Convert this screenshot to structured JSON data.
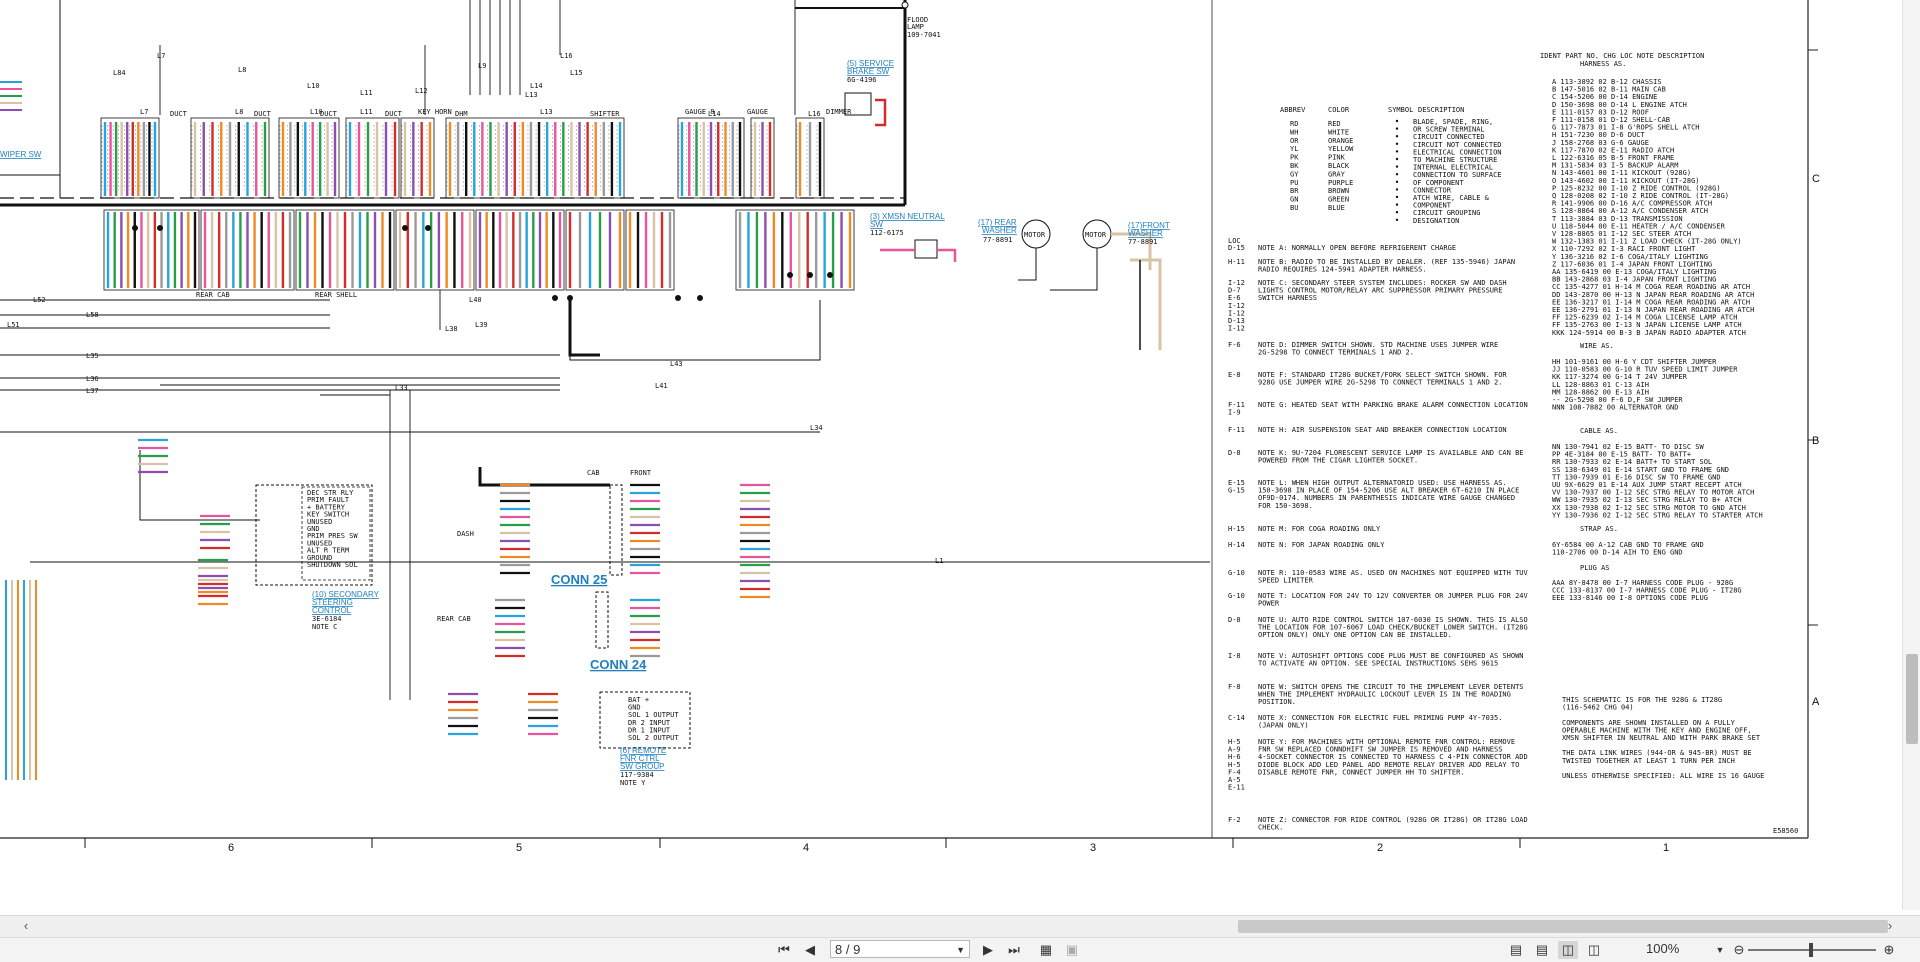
{
  "document": {
    "grid_columns": [
      "6",
      "5",
      "4",
      "3",
      "2",
      "1"
    ],
    "grid_rows": [
      "C",
      "B",
      "A"
    ],
    "drawing_no": "E58560"
  },
  "labels": {
    "flood_lamp": [
      "FLOOD",
      "LAMP",
      "109-7041"
    ],
    "service_brake": [
      "(5) SERVICE",
      "BRAKE SW",
      "6G-4196"
    ],
    "xmsn_neutral": [
      "(3) XMSN NEUTRAL",
      "SW",
      "112-6175"
    ],
    "rear_washer": [
      "(17) REAR",
      "WASHER",
      "77-8891"
    ],
    "front_washer": [
      "(17)FRONT",
      "WASHER",
      "77-8891"
    ],
    "secondary_steering": [
      "(10) SECONDARY",
      "STEERING",
      "CONTROL",
      "3E-6184",
      "NOTE C"
    ],
    "remote_fnr": [
      "(6) REMOTE",
      "FNR CTRL",
      "SW GROUP",
      "117-9384",
      "NOTE Y"
    ],
    "wiper_sw": "WIPER SW",
    "motor": "MOTOR",
    "conn25": "CONN 25",
    "conn24": "CONN 24",
    "cab": "CAB",
    "front": "FRONT",
    "dash": "DASH",
    "rear_cab": "REAR CAB",
    "rear_cab2": "REAR CAB",
    "rear_shell": "REAR SHELL"
  },
  "harness_headers": [
    "L7",
    "DUCT",
    "L8",
    "DUCT",
    "L10",
    "DUCT",
    "L11",
    "DUCT",
    "KEY HORN",
    "DHM",
    "L13",
    "SHIFTER",
    "GAUGE 8",
    "L14",
    "GAUGE",
    "L16",
    "DIMMER"
  ],
  "leads": [
    "L84",
    "L7",
    "L8",
    "L9",
    "L10",
    "L11",
    "L12",
    "L13",
    "L14",
    "L15",
    "L16",
    "L33",
    "L34",
    "L35",
    "L36",
    "L37",
    "L38",
    "L39",
    "L40",
    "L41",
    "L43",
    "L51",
    "L52",
    "L58",
    "L1"
  ],
  "secondary_steering_pins": [
    "DEC STR RLY",
    "PRIM FAULT",
    "+ BATTERY",
    "KEY SWITCH",
    "UNUSED",
    "GND",
    "PRIM PRES SW",
    "UNUSED",
    "ALT R TERM",
    "GROUND",
    "SHUTDOWN SOL"
  ],
  "remote_fnr_pins": [
    "BAT +",
    "GND",
    "SOL 1 OUTPUT",
    "DR 2 INPUT",
    "DR 1 INPUT",
    "SOL 2 OUTPUT"
  ],
  "legend": {
    "headers": [
      "ABBREV",
      "COLOR",
      "SYMBOL",
      "DESCRIPTION"
    ],
    "colors": [
      [
        "RD",
        "RED"
      ],
      [
        "WH",
        "WHITE"
      ],
      [
        "OR",
        "ORANGE"
      ],
      [
        "YL",
        "YELLOW"
      ],
      [
        "PK",
        "PINK"
      ],
      [
        "BK",
        "BLACK"
      ],
      [
        "GY",
        "GRAY"
      ],
      [
        "PU",
        "PURPLE"
      ],
      [
        "BR",
        "BROWN"
      ],
      [
        "GN",
        "GREEN"
      ],
      [
        "BU",
        "BLUE"
      ]
    ],
    "symbols": [
      "BLADE, SPADE, RING,",
      "OR SCREW TERMINAL",
      "CIRCUIT CONNECTED",
      "CIRCUIT NOT CONNECTED",
      "ELECTRICAL CONNECTION",
      "TO MACHINE STRUCTURE",
      "INTERNAL ELECTRICAL",
      "CONNECTION TO SURFACE",
      "OF COMPONENT",
      "CONNECTOR",
      "ATCH WIRE, CABLE &",
      "COMPONENT",
      "CIRCUIT GROUPING",
      "DESIGNATION"
    ]
  },
  "notes_header": "LOC",
  "notes": [
    {
      "loc": "D-15",
      "text": "NOTE A: NORMALLY OPEN BEFORE REFRIGERENT CHARGE"
    },
    {
      "loc": "H-11",
      "text": "NOTE B: RADIO TO BE INSTALLED BY DEALER. (REF 135-5946)  JAPAN RADIO REQUIRES 124-5941 ADAPTER HARNESS."
    },
    {
      "loc": "I-12 D-7 E-6 I-12 I-12 D-13 I-12",
      "text": "NOTE C: SECONDARY STEER SYSTEM INCLUDES: ROCKER SW AND DASH LIGHTS CONTROL MOTOR/RELAY ARC SUPPRESSOR PRIMARY PRESSURE SWITCH HARNESS"
    },
    {
      "loc": "F-6",
      "text": "NOTE D: DIMMER SWITCH SHOWN. STD MACHINE USES JUMPER WIRE 2G-5298 TO CONNECT TERMINALS 1 AND 2."
    },
    {
      "loc": "E-8",
      "text": "NOTE F: STANDARD IT28G BUCKET/FORK SELECT SWITCH SHOWN.  FOR 928G USE JUMPER WIRE 2G-5298 TO CONNECT TERMINALS 1 AND 2."
    },
    {
      "loc": "F-11 I-9",
      "text": "NOTE G: HEATED SEAT WITH PARKING BRAKE ALARM CONNECTION LOCATION"
    },
    {
      "loc": "F-11",
      "text": "NOTE H: AIR SUSPENSION SEAT AND BREAKER CONNECTION LOCATION"
    },
    {
      "loc": "D-8",
      "text": "NOTE K: 9U-7204 FLORESCENT SERVICE LAMP IS AVAILABLE AND CAN BE POWERED FROM THE CIGAR LIGHTER SOCKET."
    },
    {
      "loc": "E-15 G-15",
      "text": "NOTE L: WHEN HIGH OUTPUT ALTERNATORID USED: USE HARNESS AS. 150-3698 IN PLACE OF 154-5206 USE ALT BREAKER 6T-6210 IN PLACE OF9D-0174. NUMBERS IN PARENTHESIS INDICATE WIRE GAUGE CHANGED FOR 150-3698."
    },
    {
      "loc": "H-15",
      "text": "NOTE M: FOR COGA ROADING ONLY"
    },
    {
      "loc": "H-14",
      "text": "NOTE N: FOR JAPAN ROADING ONLY"
    },
    {
      "loc": "G-10",
      "text": "NOTE R: 110-0583 WIRE AS. USED ON MACHINES NOT EQUIPPED WITH TUV SPEED LIMITER"
    },
    {
      "loc": "G-10",
      "text": "NOTE T: LOCATION FOR 24V TO 12V CONVERTER OR JUMPER PLUG FOR 24V POWER"
    },
    {
      "loc": "D-8",
      "text": "NOTE U: AUTO RIDE CONTROL SWITCH 107-6030 IS SHOWN. THIS IS ALSO THE LOCATION FOR 107-6067 LOAD CHECK/BUCKET LOWER SWITCH. (IT28G OPTION ONLY) ONLY ONE OPTION CAN BE INSTALLED."
    },
    {
      "loc": "I-8",
      "text": "NOTE V: AUTOSHIFT OPTIONS CODE PLUG MUST BE CONFIGURED AS SHOWN TO ACTIVATE AN OPTION. SEE SPECIAL INSTRUCTIONS SEHS 9615"
    },
    {
      "loc": "F-8",
      "text": "NOTE W: SWITCH OPENS THE CIRCUIT TO THE IMPLEMENT LEVER DETENTS WHEN THE IMPLEMENT HYDRAULIC LOCKOUT LEVER IS IN THE ROADING POSITION."
    },
    {
      "loc": "C-14",
      "text": "NOTE X: CONNECTION FOR ELECTRIC FUEL  PRIMING PUMP 4Y-7035. (JAPAN ONLY)"
    },
    {
      "loc": "H-5 A-9 H-6 H-5 F-4 A-5 E-11",
      "text": "NOTE Y: FOR MACHINES WITH OPTIONAL REMOTE FNR CONTROL: REMOVE FNR SW  REPLACED CONNDHIFT SW JUMPER IS REMOVED AND HARNESS 4-SOCKET CONNECTOR IS CONNECTED TO HARNESS C 4-PIN CONNECTOR ADD DIODE BLOCK ADD LED PANEL ADD REMOTE RELAY DRIVER ADD RELAY TO DISABLE REMOTE FNR, CONNECT JUMPER HH TO SHIFTER."
    },
    {
      "loc": "F-2",
      "text": "NOTE Z: CONNECTOR FOR RIDE CONTROL (928G OR IT28G) OR IT28G LOAD CHECK."
    }
  ],
  "harness_table": {
    "header": "IDENT  PART NO.  CHG LOC  NOTE  DESCRIPTION",
    "subheader": "HARNESS AS.",
    "rows": [
      "A    113-3892  02 B-12       CHASSIS",
      "B    147-5016  02 B-11       MAIN CAB",
      "C    154-5206  00 D-14       ENGINE",
      "D    150-3698  00 D-14   L   ENGINE      ATCH",
      "E    111-0157  03 D-12       ROOF",
      "F    111-0158  01 D-12       SHELL-CAB",
      "G    117-7873  01 I-8        G'ROPS SHELL ATCH",
      "H    151-7230  00 D-6        DUCT",
      "J    158-2768  03 G-6        GAUGE",
      "K    117-7870  02 E-11       RADIO       ATCH",
      "L    122-6316  05 B-5        FRONT FRAME",
      "M    131-5834  03 I-5        BACKUP ALARM",
      "N    143-4601  00 I-11       KICKOUT (928G)",
      "O    143-4602  00 I-11       KICKOUT (IT-28G)",
      "P    125-8232  00 I-10   Z   RIDE CONTROL (928G)",
      "Q    128-0208  02 I-10   Z   RIDE CONTROL (IT-28G)",
      "R    141-9906  00 D-16       A/C COMPRESSOR ATCH",
      "S    128-8864  00 A-12       A/C CONDENSER  ATCH",
      "T    113-3884  03 D-13       TRANSMISSION",
      "U    118-5044  00 E-11       HEATER / A/C CONDENSER",
      "V    128-8865  01 I-12       SEC STEER   ATCH",
      "W    132-1383  01 I-11   Z   LOAD CHECK (IT-28G ONLY)",
      "X    110-7292  02 I-3        RACI FRONT LIGHT",
      "Y    136-3216  02 I-6        COGA/ITALY LIGHTING",
      "Z    117-6036  01 I-4        JAPAN FRONT LIGHTING",
      "AA   135-6419  00 E-13       COGA/ITALY LIGHTING",
      "BB   143-2868  03 I-4        JAPAN FRONT LIGHTING",
      "CC   135-4277  01 H-14   M   COGA REAR ROADING AR ATCH",
      "DD   143-2870  00 H-13   N   JAPAN REAR ROADING AR ATCH",
      "EE   136-3217  01 I-14   M   COGA REAR ROADING AR ATCH",
      "EE   136-2791  01 I-13   N   JAPAN REAR ROADING AR ATCH",
      "FF   125-6239  02 I-14   M   COGA LICENSE LAMP  ATCH",
      "FF   135-2763  00 I-13   N   JAPAN LICENSE LAMP ATCH",
      "KKK  124-5914  00 B-3    B   JAPAN RADIO ADAPTER ATCH"
    ],
    "wire_header": "WIRE AS.",
    "wire_rows": [
      "HH   101-9161  00 H-6    Y   CDT SHIFTER JUMPER",
      "JJ   110-0583  00 G-10   R   TUV SPEED LIMIT JUMPER",
      "KK   117-3274  00 G-14   T   24V JUMPER",
      "LL   128-8863  01 C-13       AIH",
      "MM   128-8862  00 E-13       AIH",
      "--   2G-5298   00 F-6  D,F   SW JUMPER",
      "NNN  108-7882  00            ALTERNATOR GND"
    ],
    "cable_header": "CABLE AS.",
    "cable_rows": [
      "NN   130-7941  02 E-15       BATT- TO DISC SW",
      "PP   4E-3184   00 E-15       BATT- TO BATT+",
      "RR   130-7933  02 E-14       BATT+ TO START SOL",
      "SS   138-6349  01 E-14       START GND TO FRAME GND",
      "TT   130-7939  01 E-16       DISC SW TO FRAME GND",
      "UU   9X-6629   01 E-14       AUX JUMP START RECEPT  ATCH",
      "VV   130-7937  00 I-12       SEC STRG RELAY TO MOTOR ATCH",
      "WW   130-7935  02 I-13       SEC STRG RELAY TO B+   ATCH",
      "XX   130-7938  02 I-12       SEC STRG MOTOR TO GND  ATCH",
      "YY   130-7936  02 I-12       SEC STRG RELAY TO STARTER ATCH"
    ],
    "strap_header": "STRAP AS.",
    "strap_rows": [
      "     6Y-6584   00 A-12       CAB GND TO FRAME GND",
      "     110-2706  00 D-14       AIH TO ENG GND"
    ],
    "plug_header": "PLUG AS",
    "plug_rows": [
      "AAA  8Y-8478   00 I-7        HARNESS CODE PLUG - 928G",
      "CCC  133-8137  00 I-7        HARNESS CODE PLUG - IT28G",
      "EEE  133-8146  00 I-8        OPTIONS CODE PLUG"
    ]
  },
  "general_notes": [
    "THIS SCHEMATIC IS FOR THE 928G & IT28G",
    "(116-5462 CHG 04)",
    "",
    "COMPONENTS ARE SHOWN INSTALLED ON A FULLY",
    "OPERABLE MACHINE WITH THE KEY AND ENGINE OFF,",
    "XMSN SHIFTER IN NEUTRAL AND WITH PARK BRAKE SET",
    "",
    "THE DATA LINK WIRES (944-OR & 945-BR) MUST BE",
    "TWISTED TOGETHER AT LEAST 1 TURN PER INCH",
    "",
    "UNLESS OTHERWISE SPECIFIED: ALL WIRE IS 16 GAUGE"
  ],
  "toolbar": {
    "page_value": "8 / 9",
    "zoom": "100%"
  },
  "colors": {
    "wire_blue": "#29a3dc",
    "wire_pink": "#e8559a",
    "wire_green": "#2a9d4a",
    "wire_tan": "#d8c3a5",
    "wire_purple": "#8a4fb0",
    "wire_red": "#d42b2b",
    "wire_orange": "#f08a24",
    "wire_gray": "#9a9a9a",
    "wire_black": "#111111",
    "link_blue": "#1f7fbf"
  }
}
